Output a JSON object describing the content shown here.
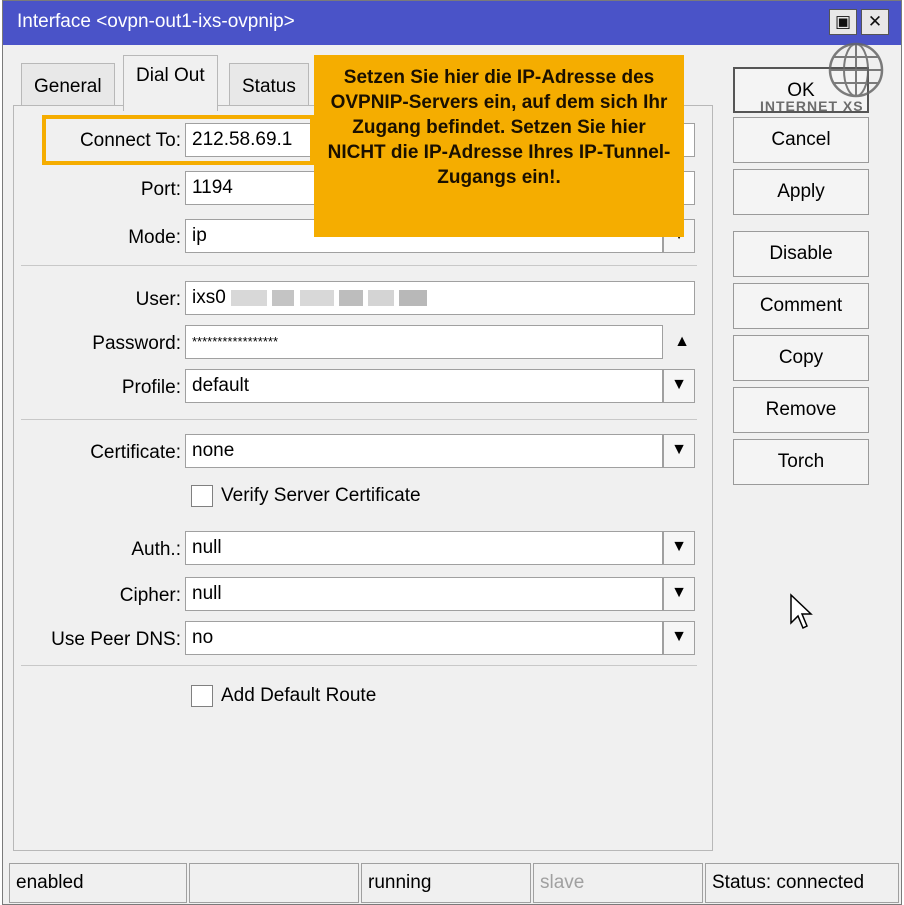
{
  "window": {
    "title": "Interface <ovpn-out1-ixs-ovpnip>"
  },
  "tabs": [
    {
      "label": "General"
    },
    {
      "label": "Dial Out"
    },
    {
      "label": "Status"
    }
  ],
  "tooltip": {
    "text": "Setzen Sie hier die IP-Adresse des OVPNIP-Servers ein, auf dem sich Ihr Zugang befindet. Setzen Sie hier NICHT die IP-Adresse Ihres IP-Tunnel-Zugangs ein!."
  },
  "form": {
    "connect_to": {
      "label": "Connect To:",
      "value": "212.58.69.1"
    },
    "port": {
      "label": "Port:",
      "value": "1194"
    },
    "mode": {
      "label": "Mode:",
      "value": "ip"
    },
    "user": {
      "label": "User:",
      "value": "ixs0"
    },
    "password": {
      "label": "Password:",
      "value": "*****************"
    },
    "profile": {
      "label": "Profile:",
      "value": "default"
    },
    "certificate": {
      "label": "Certificate:",
      "value": "none"
    },
    "verify_server_certificate": {
      "label": "Verify Server Certificate",
      "checked": false
    },
    "auth": {
      "label": "Auth.:",
      "value": "null"
    },
    "cipher": {
      "label": "Cipher:",
      "value": "null"
    },
    "use_peer_dns": {
      "label": "Use Peer DNS:",
      "value": "no"
    },
    "add_default_route": {
      "label": "Add Default Route",
      "checked": false
    }
  },
  "buttons": {
    "ok": "OK",
    "cancel": "Cancel",
    "apply": "Apply",
    "disable": "Disable",
    "comment": "Comment",
    "copy": "Copy",
    "remove": "Remove",
    "torch": "Torch"
  },
  "statusbar": {
    "state": "enabled",
    "empty": "",
    "running": "running",
    "slave": "slave",
    "status": "Status: connected"
  },
  "logo": {
    "text": "INTERNET XS"
  },
  "icons": {
    "dropdown": "dropdown-arrow-icon",
    "password_toggle": "triangle-up-icon",
    "maximize": "maximize-icon",
    "close": "close-icon",
    "cursor": "mouse-cursor-icon"
  }
}
